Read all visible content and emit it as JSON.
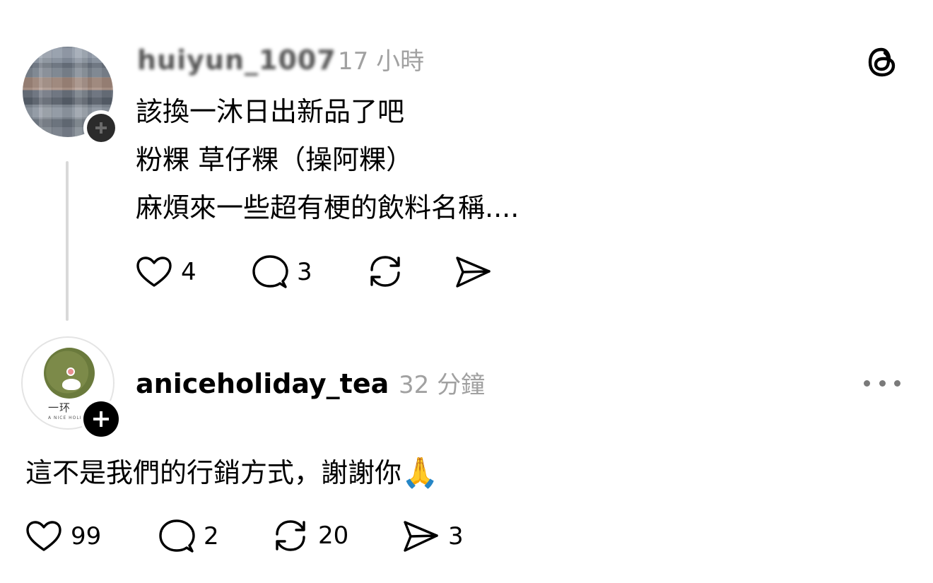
{
  "post": {
    "username": "huiyun_1007",
    "time": "17 小時",
    "lines": [
      "該換一沐日出新品了吧",
      "粉粿 草仔粿（操阿粿）",
      "麻煩來一些超有梗的飲料名稱...."
    ],
    "likes": "4",
    "comments": "3"
  },
  "reply": {
    "username": "aniceholiday_tea",
    "time": "32 分鐘",
    "text": "這不是我們的行銷方式，謝謝你",
    "emoji": "🙏",
    "likes": "99",
    "comments": "2",
    "reposts": "20",
    "shares": "3",
    "avatar_logo_text": "一环",
    "avatar_logo_sub": "A NICE HOLI"
  },
  "icons": {
    "app_logo": "threads-logo-icon",
    "like": "heart-icon",
    "comment": "speech-bubble-icon",
    "repost": "repost-arrows-icon",
    "share": "send-icon",
    "more": "more-dots-icon",
    "follow": "plus-icon"
  },
  "colors": {
    "text": "#000000",
    "muted": "#a1a1a1",
    "thread_line": "#d9d9d9",
    "avatar_green": "#7c8a49"
  }
}
